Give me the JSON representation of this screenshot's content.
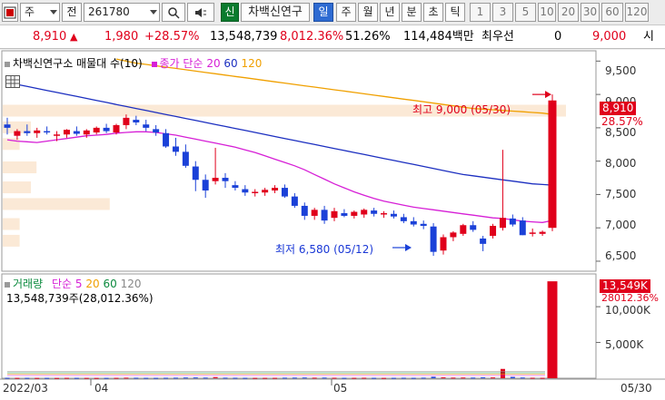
{
  "toolbar": {
    "type_box": "주",
    "stock_code": "261780",
    "stock_name": "차백신연구",
    "prefix_label": "전",
    "badge_label": "신",
    "periods": [
      "일",
      "주",
      "월",
      "년",
      "분",
      "초",
      "틱"
    ],
    "active_period": "일",
    "numbers": [
      "1",
      "3",
      "5",
      "10",
      "20",
      "30",
      "60",
      "120"
    ]
  },
  "price_bar": {
    "price": "8,910",
    "change": "1,980",
    "change_rate": "+28.57%",
    "volume": "13,548,739",
    "volume_rate": "8,012.36%",
    "extra_rate": "51.26%",
    "amount": "114,484백만",
    "priority_label": "최우선",
    "priority_qty": "0",
    "priority_price": "9,000",
    "tail": "시"
  },
  "price_panel": {
    "legend_name": "차백신연구소 매물대 수(10)",
    "ma_label": "종가 단순",
    "ma_periods": [
      "20",
      "60",
      "120"
    ],
    "ma_colors": [
      "#d61fd6",
      "#1c2fc0",
      "#f0a000"
    ],
    "high_annotation": "최고 9,000 (05/30)",
    "low_annotation": "최저 6,580 (05/12)",
    "last_price_tag": "8,910",
    "last_rate_tag": "28.57%",
    "y_ticks": [
      "9,500",
      "9,000",
      "8,500",
      "8,000",
      "7,500",
      "7,000",
      "6,500"
    ]
  },
  "volume_panel": {
    "legend_name": "거래량",
    "legend_ma_label": "단순",
    "legend_periods": [
      "5",
      "20",
      "60",
      "120"
    ],
    "total_text": "13,548,739주(28,012.36%)",
    "volume_tag": "13,549K",
    "volume_rate_tag": "28012.36%",
    "y_ticks": [
      "10,000K",
      "5,000K"
    ]
  },
  "x_axis": {
    "labels": [
      "2022/03",
      "04",
      "05"
    ],
    "right_date": "05/30"
  },
  "chart_data": {
    "type": "candlestick",
    "y_range": [
      6350,
      9600
    ],
    "candles": [
      {
        "o": 8550,
        "h": 8650,
        "l": 8400,
        "c": 8500
      },
      {
        "o": 8380,
        "h": 8480,
        "l": 8320,
        "c": 8450
      },
      {
        "o": 8450,
        "h": 8550,
        "l": 8380,
        "c": 8420
      },
      {
        "o": 8420,
        "h": 8500,
        "l": 8350,
        "c": 8460
      },
      {
        "o": 8450,
        "h": 8520,
        "l": 8400,
        "c": 8430
      },
      {
        "o": 8380,
        "h": 8450,
        "l": 8300,
        "c": 8400
      },
      {
        "o": 8400,
        "h": 8480,
        "l": 8350,
        "c": 8470
      },
      {
        "o": 8450,
        "h": 8520,
        "l": 8380,
        "c": 8410
      },
      {
        "o": 8400,
        "h": 8480,
        "l": 8350,
        "c": 8460
      },
      {
        "o": 8430,
        "h": 8520,
        "l": 8400,
        "c": 8500
      },
      {
        "o": 8500,
        "h": 8560,
        "l": 8420,
        "c": 8450
      },
      {
        "o": 8430,
        "h": 8560,
        "l": 8400,
        "c": 8540
      },
      {
        "o": 8540,
        "h": 8700,
        "l": 8480,
        "c": 8650
      },
      {
        "o": 8620,
        "h": 8680,
        "l": 8540,
        "c": 8580
      },
      {
        "o": 8550,
        "h": 8620,
        "l": 8450,
        "c": 8500
      },
      {
        "o": 8480,
        "h": 8540,
        "l": 8380,
        "c": 8430
      },
      {
        "o": 8420,
        "h": 8480,
        "l": 8200,
        "c": 8220
      },
      {
        "o": 8220,
        "h": 8350,
        "l": 8080,
        "c": 8140
      },
      {
        "o": 8140,
        "h": 8250,
        "l": 7900,
        "c": 7930
      },
      {
        "o": 7920,
        "h": 8000,
        "l": 7550,
        "c": 7720
      },
      {
        "o": 7720,
        "h": 7800,
        "l": 7450,
        "c": 7560
      },
      {
        "o": 7700,
        "h": 8200,
        "l": 7650,
        "c": 7750
      },
      {
        "o": 7750,
        "h": 7820,
        "l": 7600,
        "c": 7700
      },
      {
        "o": 7640,
        "h": 7700,
        "l": 7560,
        "c": 7600
      },
      {
        "o": 7580,
        "h": 7640,
        "l": 7480,
        "c": 7530
      },
      {
        "o": 7520,
        "h": 7580,
        "l": 7470,
        "c": 7540
      },
      {
        "o": 7530,
        "h": 7600,
        "l": 7480,
        "c": 7570
      },
      {
        "o": 7560,
        "h": 7640,
        "l": 7520,
        "c": 7600
      },
      {
        "o": 7600,
        "h": 7650,
        "l": 7450,
        "c": 7470
      },
      {
        "o": 7470,
        "h": 7520,
        "l": 7300,
        "c": 7330
      },
      {
        "o": 7330,
        "h": 7380,
        "l": 7120,
        "c": 7180
      },
      {
        "o": 7180,
        "h": 7300,
        "l": 7120,
        "c": 7270
      },
      {
        "o": 7270,
        "h": 7330,
        "l": 7060,
        "c": 7110
      },
      {
        "o": 7150,
        "h": 7300,
        "l": 7100,
        "c": 7250
      },
      {
        "o": 7220,
        "h": 7280,
        "l": 7160,
        "c": 7180
      },
      {
        "o": 7180,
        "h": 7260,
        "l": 7140,
        "c": 7240
      },
      {
        "o": 7200,
        "h": 7290,
        "l": 7150,
        "c": 7270
      },
      {
        "o": 7260,
        "h": 7300,
        "l": 7170,
        "c": 7210
      },
      {
        "o": 7200,
        "h": 7250,
        "l": 7150,
        "c": 7220
      },
      {
        "o": 7210,
        "h": 7260,
        "l": 7140,
        "c": 7170
      },
      {
        "o": 7160,
        "h": 7210,
        "l": 7070,
        "c": 7100
      },
      {
        "o": 7100,
        "h": 7160,
        "l": 7020,
        "c": 7050
      },
      {
        "o": 7060,
        "h": 7110,
        "l": 6980,
        "c": 7030
      },
      {
        "o": 7020,
        "h": 7070,
        "l": 6580,
        "c": 6640
      },
      {
        "o": 6660,
        "h": 6900,
        "l": 6600,
        "c": 6860
      },
      {
        "o": 6860,
        "h": 6950,
        "l": 6800,
        "c": 6930
      },
      {
        "o": 6910,
        "h": 7060,
        "l": 6880,
        "c": 7040
      },
      {
        "o": 7040,
        "h": 7100,
        "l": 6940,
        "c": 6970
      },
      {
        "o": 6840,
        "h": 6880,
        "l": 6650,
        "c": 6760
      },
      {
        "o": 6880,
        "h": 7060,
        "l": 6840,
        "c": 7030
      },
      {
        "o": 7000,
        "h": 8170,
        "l": 6960,
        "c": 7150
      },
      {
        "o": 7140,
        "h": 7200,
        "l": 7020,
        "c": 7050
      },
      {
        "o": 7110,
        "h": 7160,
        "l": 6890,
        "c": 6890
      },
      {
        "o": 6910,
        "h": 6990,
        "l": 6870,
        "c": 6930
      },
      {
        "o": 6910,
        "h": 6960,
        "l": 6880,
        "c": 6940
      },
      {
        "o": 7000,
        "h": 9000,
        "l": 6950,
        "c": 8910
      }
    ],
    "ma20": [
      8320,
      8300,
      8290,
      8280,
      8300,
      8320,
      8340,
      8360,
      8380,
      8390,
      8400,
      8420,
      8430,
      8440,
      8440,
      8430,
      8410,
      8390,
      8360,
      8330,
      8300,
      8270,
      8240,
      8210,
      8170,
      8130,
      8080,
      8030,
      7980,
      7930,
      7870,
      7800,
      7730,
      7660,
      7600,
      7540,
      7490,
      7440,
      7400,
      7370,
      7340,
      7310,
      7290,
      7270,
      7250,
      7230,
      7210,
      7190,
      7170,
      7150,
      7140,
      7120,
      7100,
      7090,
      7080,
      7110
    ],
    "ma60": [
      9180,
      9150,
      9120,
      9090,
      9060,
      9030,
      9000,
      8970,
      8940,
      8910,
      8880,
      8850,
      8820,
      8790,
      8760,
      8730,
      8700,
      8670,
      8640,
      8610,
      8580,
      8550,
      8520,
      8490,
      8460,
      8430,
      8400,
      8370,
      8340,
      8310,
      8280,
      8250,
      8220,
      8190,
      8160,
      8130,
      8100,
      8070,
      8040,
      8010,
      7980,
      7950,
      7920,
      7890,
      7860,
      7830,
      7800,
      7780,
      7760,
      7740,
      7720,
      7700,
      7680,
      7660,
      7650,
      7640
    ],
    "ma120": [
      null,
      null,
      null,
      null,
      null,
      null,
      null,
      null,
      null,
      null,
      null,
      9530,
      9500,
      9470,
      9450,
      9430,
      9410,
      9390,
      9370,
      9350,
      9330,
      9310,
      9290,
      9270,
      9250,
      9230,
      9210,
      9190,
      9170,
      9150,
      9130,
      9110,
      9090,
      9070,
      9050,
      9030,
      9010,
      8990,
      8970,
      8950,
      8930,
      8910,
      8890,
      8870,
      8850,
      8830,
      8810,
      8790,
      8780,
      8770,
      8760,
      8750,
      8740,
      8730,
      8720,
      8700
    ],
    "volume_profile": [
      {
        "price": 8750,
        "size": 1.0
      },
      {
        "price": 8500,
        "size": 0.05
      },
      {
        "price": 8250,
        "size": 0.03
      },
      {
        "price": 7900,
        "size": 0.06
      },
      {
        "price": 7600,
        "size": 0.05
      },
      {
        "price": 7350,
        "size": 0.19
      },
      {
        "price": 7050,
        "size": 0.03
      },
      {
        "price": 6800,
        "size": 0.03
      }
    ],
    "volumes_k": [
      60,
      50,
      55,
      45,
      50,
      40,
      60,
      55,
      50,
      45,
      50,
      60,
      80,
      70,
      60,
      55,
      70,
      80,
      100,
      110,
      90,
      150,
      80,
      70,
      60,
      50,
      55,
      60,
      80,
      90,
      100,
      80,
      90,
      70,
      60,
      60,
      70,
      60,
      50,
      60,
      70,
      60,
      80,
      200,
      120,
      90,
      100,
      90,
      120,
      110,
      1300,
      180,
      100,
      70,
      60,
      13549
    ],
    "volume_y_range": [
      0,
      14200
    ]
  }
}
